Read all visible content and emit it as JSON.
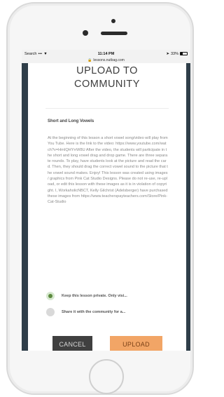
{
  "status_bar": {
    "carrier": "Search",
    "time": "11:14 PM",
    "battery": "33%"
  },
  "browser": {
    "url": "lessons.nutbag.com"
  },
  "modal": {
    "title_line1": "UPLOAD TO",
    "title_line2": "COMMUNITY",
    "lesson_title": "Short and Long Vowels",
    "description": "At the beginning of this lesson a short vowel song/video will play from You Tube. Here is the link to the video: https://www.youtube.com/watch?v=HmIQHYrrW8U After the video, the students will participate in the short and long vowel drag and drop game. There are three separate rounds. To play, have students look at the picture and read the card. Then, they should drag the correct vowel sound to the picture that the vowel sound makes. Enjoy! This lesson was created using images / graphics from Pink Cat Studio Designs. Please do not re-use, re-upload, or edit this lesson with these images as it is in violation of copyright. I, WorkaholicNBCT, Kelly Gilchrist (Adelsberger) have purchased these images from https://www.teacherspayteachers.com/Store/Pink-Cat-Studio",
    "options": [
      {
        "label": "Keep this lesson private. Only visi...",
        "selected": true
      },
      {
        "label": "Share it with the community for a...",
        "selected": false
      }
    ],
    "cancel_label": "CANCEL",
    "upload_label": "UPLOAD"
  },
  "colors": {
    "upload_button": "#f2a566",
    "cancel_button": "#404040",
    "radio_selected": "#5c8a3e"
  }
}
